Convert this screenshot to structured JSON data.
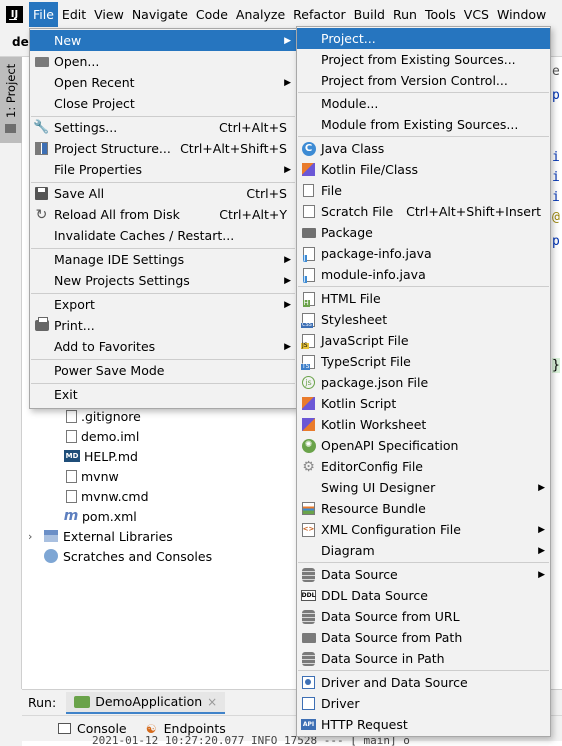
{
  "menubar": {
    "app_icon": "intellij-logo",
    "app_icon_text": "IJ",
    "items": [
      "File",
      "Edit",
      "View",
      "Navigate",
      "Code",
      "Analyze",
      "Refactor",
      "Build",
      "Run",
      "Tools",
      "VCS",
      "Window"
    ],
    "active": "File"
  },
  "project": {
    "crumb": "demo",
    "side_tab": "1: Project"
  },
  "tree": {
    "files": [
      {
        "name": ".gitignore",
        "icon": "file-icon"
      },
      {
        "name": "demo.iml",
        "icon": "iml-file-icon"
      },
      {
        "name": "HELP.md",
        "icon": "markdown-icon"
      },
      {
        "name": "mvnw",
        "icon": "file-icon"
      },
      {
        "name": "mvnw.cmd",
        "icon": "file-icon"
      },
      {
        "name": "pom.xml",
        "icon": "maven-icon"
      }
    ],
    "external_libraries": "External Libraries",
    "scratches": "Scratches and Consoles"
  },
  "editor_chars": [
    "e",
    "p",
    "i",
    "i",
    "i",
    "@",
    "p",
    "}"
  ],
  "run": {
    "label": "Run:",
    "tab": "DemoApplication",
    "close_icon": "close-icon",
    "console": "Console",
    "endpoints": "Endpoints",
    "log_line": "2021-01-12 10:27:20.077  INFO 17528 --- [           main] o"
  },
  "file_menu": {
    "new": "New",
    "open": "Open...",
    "open_recent": "Open Recent",
    "close_project": "Close Project",
    "settings": "Settings...",
    "settings_sc": "Ctrl+Alt+S",
    "project_structure": "Project Structure...",
    "project_structure_sc": "Ctrl+Alt+Shift+S",
    "file_properties": "File Properties",
    "save_all": "Save All",
    "save_all_sc": "Ctrl+S",
    "reload": "Reload All from Disk",
    "reload_sc": "Ctrl+Alt+Y",
    "invalidate": "Invalidate Caches / Restart...",
    "manage_ide": "Manage IDE Settings",
    "new_projects_settings": "New Projects Settings",
    "export": "Export",
    "print": "Print...",
    "add_favorites": "Add to Favorites",
    "power_save": "Power Save Mode",
    "exit": "Exit"
  },
  "new_menu": {
    "project": "Project...",
    "project_existing": "Project from Existing Sources...",
    "project_vcs": "Project from Version Control...",
    "module": "Module...",
    "module_existing": "Module from Existing Sources...",
    "java_class": "Java Class",
    "java_class_glyph": "C",
    "kotlin_file": "Kotlin File/Class",
    "file": "File",
    "scratch_file": "Scratch File",
    "scratch_file_sc": "Ctrl+Alt+Shift+Insert",
    "package": "Package",
    "package_info": "package-info.java",
    "module_info": "module-info.java",
    "html_file": "HTML File",
    "stylesheet": "Stylesheet",
    "javascript_file": "JavaScript File",
    "typescript_file": "TypeScript File",
    "package_json": "package.json File",
    "package_json_glyph": "js",
    "kotlin_script": "Kotlin Script",
    "kotlin_worksheet": "Kotlin Worksheet",
    "openapi": "OpenAPI Specification",
    "editorconfig": "EditorConfig File",
    "swing_ui": "Swing UI Designer",
    "resource_bundle": "Resource Bundle",
    "xml_config": "XML Configuration File",
    "xml_glyph": "<>",
    "diagram": "Diagram",
    "data_source": "Data Source",
    "ddl_data_source": "DDL Data Source",
    "ddl_glyph": "DDL",
    "data_source_url": "Data Source from URL",
    "data_source_path": "Data Source from Path",
    "data_source_in_path": "Data Source in Path",
    "driver_data_source": "Driver and Data Source",
    "driver": "Driver",
    "http_request": "HTTP Request",
    "api_glyph": "API"
  },
  "colors": {
    "highlight": "#2675bf",
    "menu_bg": "#f2f2f2"
  }
}
